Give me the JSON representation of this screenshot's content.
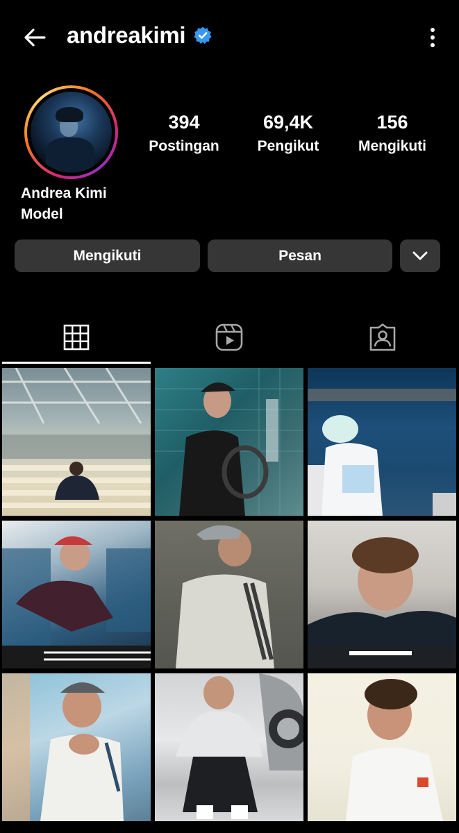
{
  "header": {
    "username": "andreakimi",
    "verified": true,
    "back_icon": "arrow-left-icon",
    "more_icon": "more-vertical-icon"
  },
  "profile": {
    "stats": [
      {
        "value": "394",
        "label": "Postingan"
      },
      {
        "value": "69,4K",
        "label": "Pengikut"
      },
      {
        "value": "156",
        "label": "Mengikuti"
      }
    ],
    "name": "Andrea Kimi",
    "category": "Model"
  },
  "actions": {
    "follow_label": "Mengikuti",
    "message_label": "Pesan",
    "more_icon": "chevron-down-icon"
  },
  "tabs": [
    {
      "icon": "grid-icon",
      "active": true
    },
    {
      "icon": "reels-icon",
      "active": false
    },
    {
      "icon": "tagged-icon",
      "active": false
    }
  ],
  "colors": {
    "background": "#000000",
    "button": "#363636",
    "verified": "#3897f0",
    "text": "#ffffff"
  }
}
